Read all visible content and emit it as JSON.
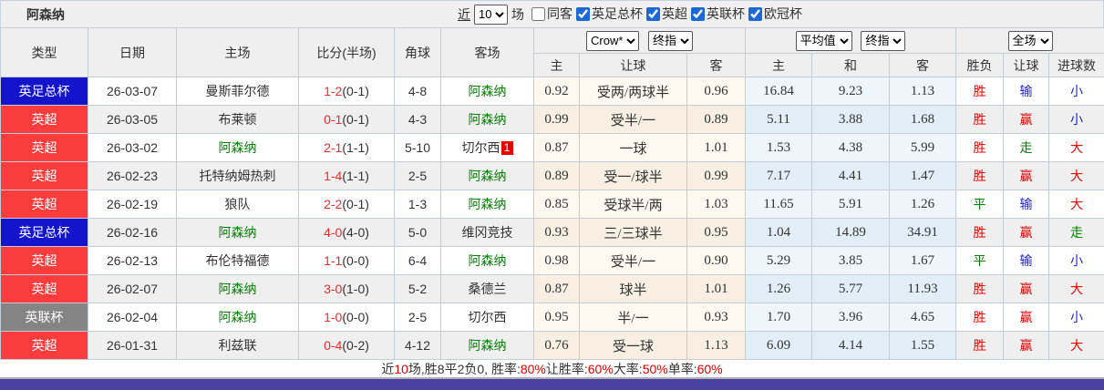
{
  "title": "阿森纳",
  "filter": {
    "near_label": "近",
    "games_value": "10",
    "games_suffix": "场",
    "checkboxes": [
      {
        "label": "同客",
        "checked": false
      },
      {
        "label": "英足总杯",
        "checked": true
      },
      {
        "label": "英超",
        "checked": true
      },
      {
        "label": "英联杯",
        "checked": true
      },
      {
        "label": "欧冠杯",
        "checked": true
      }
    ]
  },
  "header": {
    "static_cols": [
      "类型",
      "日期",
      "主场",
      "比分(半场)",
      "角球",
      "客场"
    ],
    "groups": [
      {
        "selects": [
          "Crow*",
          "终指"
        ],
        "sub": [
          "主",
          "让球",
          "客"
        ]
      },
      {
        "selects": [
          "平均值",
          "终指"
        ],
        "sub": [
          "主",
          "和",
          "客"
        ]
      },
      {
        "selects": [
          "全场"
        ],
        "sub": [
          "胜负",
          "让球",
          "进球数"
        ]
      }
    ]
  },
  "league_colors": {
    "英足总杯": "#1414cc",
    "英超": "#fa3c3c",
    "英联杯": "#848484"
  },
  "team_highlight": {
    "name": "阿森纳",
    "color": "#008000"
  },
  "result_colors": {
    "胜": "#e60000",
    "平": "#008000",
    "负": "#2222cc",
    "赢": "#e60000",
    "输": "#2222cc",
    "走": "#008000",
    "大": "#e60000",
    "小": "#2222cc"
  },
  "rows": [
    {
      "type": "英足总杯",
      "date": "26-03-07",
      "home": "曼斯菲尔德",
      "score": "1-2",
      "half": "(0-1)",
      "corners": "4-8",
      "away": "阿森纳",
      "away_badge": "",
      "odds_home": "0.92",
      "odds_line": "受两/两球半",
      "odds_away": "0.96",
      "avg_home": "16.84",
      "avg_draw": "9.23",
      "avg_away": "1.13",
      "wdl": "胜",
      "handicap": "输",
      "goals": "小"
    },
    {
      "type": "英超",
      "date": "26-03-05",
      "home": "布莱顿",
      "score": "0-1",
      "half": "(0-1)",
      "corners": "4-3",
      "away": "阿森纳",
      "away_badge": "",
      "odds_home": "0.99",
      "odds_line": "受半/一",
      "odds_away": "0.89",
      "avg_home": "5.11",
      "avg_draw": "3.88",
      "avg_away": "1.68",
      "wdl": "胜",
      "handicap": "赢",
      "goals": "小"
    },
    {
      "type": "英超",
      "date": "26-03-02",
      "home": "阿森纳",
      "score": "2-1",
      "half": "(1-1)",
      "corners": "5-10",
      "away": "切尔西",
      "away_badge": "1",
      "odds_home": "0.87",
      "odds_line": "一球",
      "odds_away": "1.01",
      "avg_home": "1.53",
      "avg_draw": "4.38",
      "avg_away": "5.99",
      "wdl": "胜",
      "handicap": "走",
      "goals": "大"
    },
    {
      "type": "英超",
      "date": "26-02-23",
      "home": "托特纳姆热刺",
      "score": "1-4",
      "half": "(1-1)",
      "corners": "2-5",
      "away": "阿森纳",
      "away_badge": "",
      "odds_home": "0.89",
      "odds_line": "受一/球半",
      "odds_away": "0.99",
      "avg_home": "7.17",
      "avg_draw": "4.41",
      "avg_away": "1.47",
      "wdl": "胜",
      "handicap": "赢",
      "goals": "大"
    },
    {
      "type": "英超",
      "date": "26-02-19",
      "home": "狼队",
      "score": "2-2",
      "half": "(0-1)",
      "corners": "1-3",
      "away": "阿森纳",
      "away_badge": "",
      "odds_home": "0.85",
      "odds_line": "受球半/两",
      "odds_away": "1.03",
      "avg_home": "11.65",
      "avg_draw": "5.91",
      "avg_away": "1.26",
      "wdl": "平",
      "handicap": "输",
      "goals": "大"
    },
    {
      "type": "英足总杯",
      "date": "26-02-16",
      "home": "阿森纳",
      "score": "4-0",
      "half": "(4-0)",
      "corners": "5-0",
      "away": "维冈竞技",
      "away_badge": "",
      "odds_home": "0.93",
      "odds_line": "三/三球半",
      "odds_away": "0.95",
      "avg_home": "1.04",
      "avg_draw": "14.89",
      "avg_away": "34.91",
      "wdl": "胜",
      "handicap": "赢",
      "goals": "走"
    },
    {
      "type": "英超",
      "date": "26-02-13",
      "home": "布伦特福德",
      "score": "1-1",
      "half": "(0-0)",
      "corners": "6-4",
      "away": "阿森纳",
      "away_badge": "",
      "odds_home": "0.98",
      "odds_line": "受半/一",
      "odds_away": "0.90",
      "avg_home": "5.29",
      "avg_draw": "3.85",
      "avg_away": "1.67",
      "wdl": "平",
      "handicap": "输",
      "goals": "小"
    },
    {
      "type": "英超",
      "date": "26-02-07",
      "home": "阿森纳",
      "score": "3-0",
      "half": "(1-0)",
      "corners": "5-2",
      "away": "桑德兰",
      "away_badge": "",
      "odds_home": "0.87",
      "odds_line": "球半",
      "odds_away": "1.01",
      "avg_home": "1.26",
      "avg_draw": "5.77",
      "avg_away": "11.93",
      "wdl": "胜",
      "handicap": "赢",
      "goals": "大"
    },
    {
      "type": "英联杯",
      "date": "26-02-04",
      "home": "阿森纳",
      "score": "1-0",
      "half": "(0-0)",
      "corners": "2-5",
      "away": "切尔西",
      "away_badge": "",
      "odds_home": "0.95",
      "odds_line": "半/一",
      "odds_away": "0.93",
      "avg_home": "1.70",
      "avg_draw": "3.96",
      "avg_away": "4.65",
      "wdl": "胜",
      "handicap": "赢",
      "goals": "小"
    },
    {
      "type": "英超",
      "date": "26-01-31",
      "home": "利兹联",
      "score": "0-4",
      "half": "(0-2)",
      "corners": "4-12",
      "away": "阿森纳",
      "away_badge": "",
      "odds_home": "0.76",
      "odds_line": "受一球",
      "odds_away": "1.13",
      "avg_home": "6.09",
      "avg_draw": "4.14",
      "avg_away": "1.55",
      "wdl": "胜",
      "handicap": "赢",
      "goals": "大"
    }
  ],
  "footer": {
    "segments": [
      {
        "text": "近",
        "red": false
      },
      {
        "text": "10",
        "red": true
      },
      {
        "text": "场,胜8平2负0, 胜率:",
        "red": false
      },
      {
        "text": "80%",
        "red": true
      },
      {
        "text": " 让胜率:",
        "red": false
      },
      {
        "text": "60%",
        "red": true
      },
      {
        "text": " 大率:",
        "red": false
      },
      {
        "text": "50%",
        "red": true
      },
      {
        "text": " 单率:",
        "red": false
      },
      {
        "text": "60%",
        "red": true
      }
    ]
  }
}
